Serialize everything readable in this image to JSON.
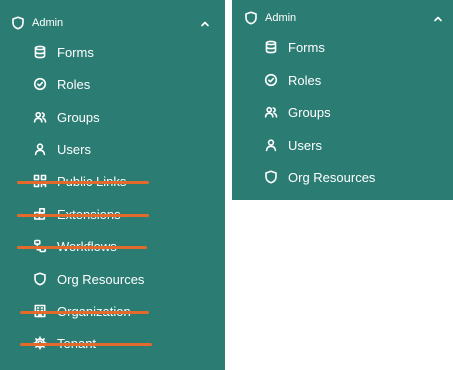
{
  "theme": {
    "teal": "#2b7d74",
    "strike": "#e36a2b",
    "text": "#ffffff"
  },
  "left": {
    "header": {
      "title": "Admin",
      "icon": "shield-icon",
      "chevron": "chevron-up-icon"
    },
    "items": [
      {
        "label": "Forms",
        "icon": "database-icon",
        "struck": false
      },
      {
        "label": "Roles",
        "icon": "check-circle-icon",
        "struck": false
      },
      {
        "label": "Groups",
        "icon": "users-icon",
        "struck": false
      },
      {
        "label": "Users",
        "icon": "user-icon",
        "struck": false
      },
      {
        "label": "Public Links",
        "icon": "qr-code-icon",
        "struck": true
      },
      {
        "label": "Extensions",
        "icon": "puzzle-icon",
        "struck": true
      },
      {
        "label": "Workflows",
        "icon": "workflow-icon",
        "struck": true
      },
      {
        "label": "Org Resources",
        "icon": "shield-icon",
        "struck": false
      },
      {
        "label": "Organization",
        "icon": "building-icon",
        "struck": true
      },
      {
        "label": "Tenant",
        "icon": "gear-icon",
        "struck": true
      }
    ]
  },
  "right": {
    "header": {
      "title": "Admin",
      "icon": "shield-icon",
      "chevron": "chevron-up-icon"
    },
    "items": [
      {
        "label": "Forms",
        "icon": "database-icon"
      },
      {
        "label": "Roles",
        "icon": "check-circle-icon"
      },
      {
        "label": "Groups",
        "icon": "users-icon"
      },
      {
        "label": "Users",
        "icon": "user-icon"
      },
      {
        "label": "Org Resources",
        "icon": "shield-icon"
      }
    ]
  }
}
